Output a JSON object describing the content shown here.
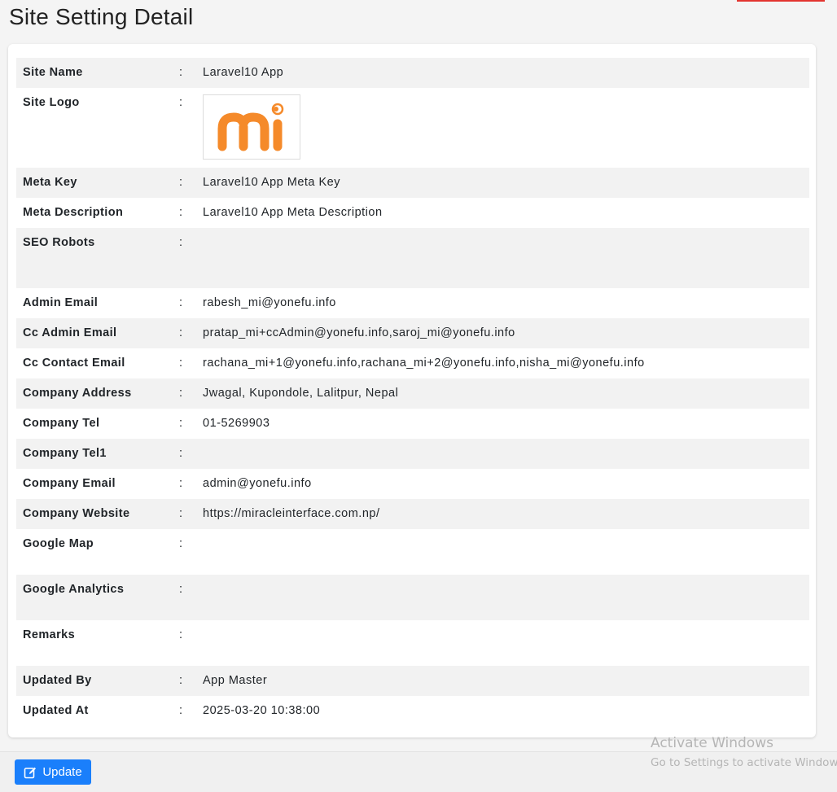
{
  "page": {
    "title": "Site Setting Detail"
  },
  "rows": {
    "site_name": {
      "label": "Site Name",
      "value": "Laravel10 App"
    },
    "site_logo": {
      "label": "Site Logo",
      "logo_text": "mi"
    },
    "meta_key": {
      "label": "Meta Key",
      "value": "Laravel10 App Meta Key"
    },
    "meta_description": {
      "label": "Meta Description",
      "value": "Laravel10 App Meta Description"
    },
    "seo_robots": {
      "label": "SEO Robots",
      "value": ""
    },
    "admin_email": {
      "label": "Admin Email",
      "value": "rabesh_mi@yonefu.info"
    },
    "cc_admin_email": {
      "label": "Cc Admin Email",
      "value": "pratap_mi+ccAdmin@yonefu.info,saroj_mi@yonefu.info"
    },
    "cc_contact_email": {
      "label": "Cc Contact Email",
      "value": "rachana_mi+1@yonefu.info,rachana_mi+2@yonefu.info,nisha_mi@yonefu.info"
    },
    "company_address": {
      "label": "Company Address",
      "value": "Jwagal, Kupondole, Lalitpur, Nepal"
    },
    "company_tel": {
      "label": "Company Tel",
      "value": "01-5269903"
    },
    "company_tel1": {
      "label": "Company Tel1",
      "value": ""
    },
    "company_email": {
      "label": "Company Email",
      "value": "admin@yonefu.info"
    },
    "company_website": {
      "label": "Company Website",
      "value": "https://miracleinterface.com.np/"
    },
    "google_map": {
      "label": "Google Map",
      "value": ""
    },
    "google_analytics": {
      "label": "Google Analytics",
      "value": ""
    },
    "remarks": {
      "label": "Remarks",
      "value": ""
    },
    "updated_by": {
      "label": "Updated By",
      "value": "App Master"
    },
    "updated_at": {
      "label": "Updated At",
      "value": "2025-03-20 10:38:00"
    }
  },
  "separator": ":",
  "footer": {
    "update_label": "Update",
    "update_icon": "edit-icon"
  },
  "watermark": {
    "title": "Activate Windows",
    "subtitle": "Go to Settings to activate Windows."
  },
  "colors": {
    "primary": "#1a7ffb",
    "logo_orange": "#f58a2a",
    "stripe": "#f2f2f2",
    "accent_red": "#e3342f"
  }
}
